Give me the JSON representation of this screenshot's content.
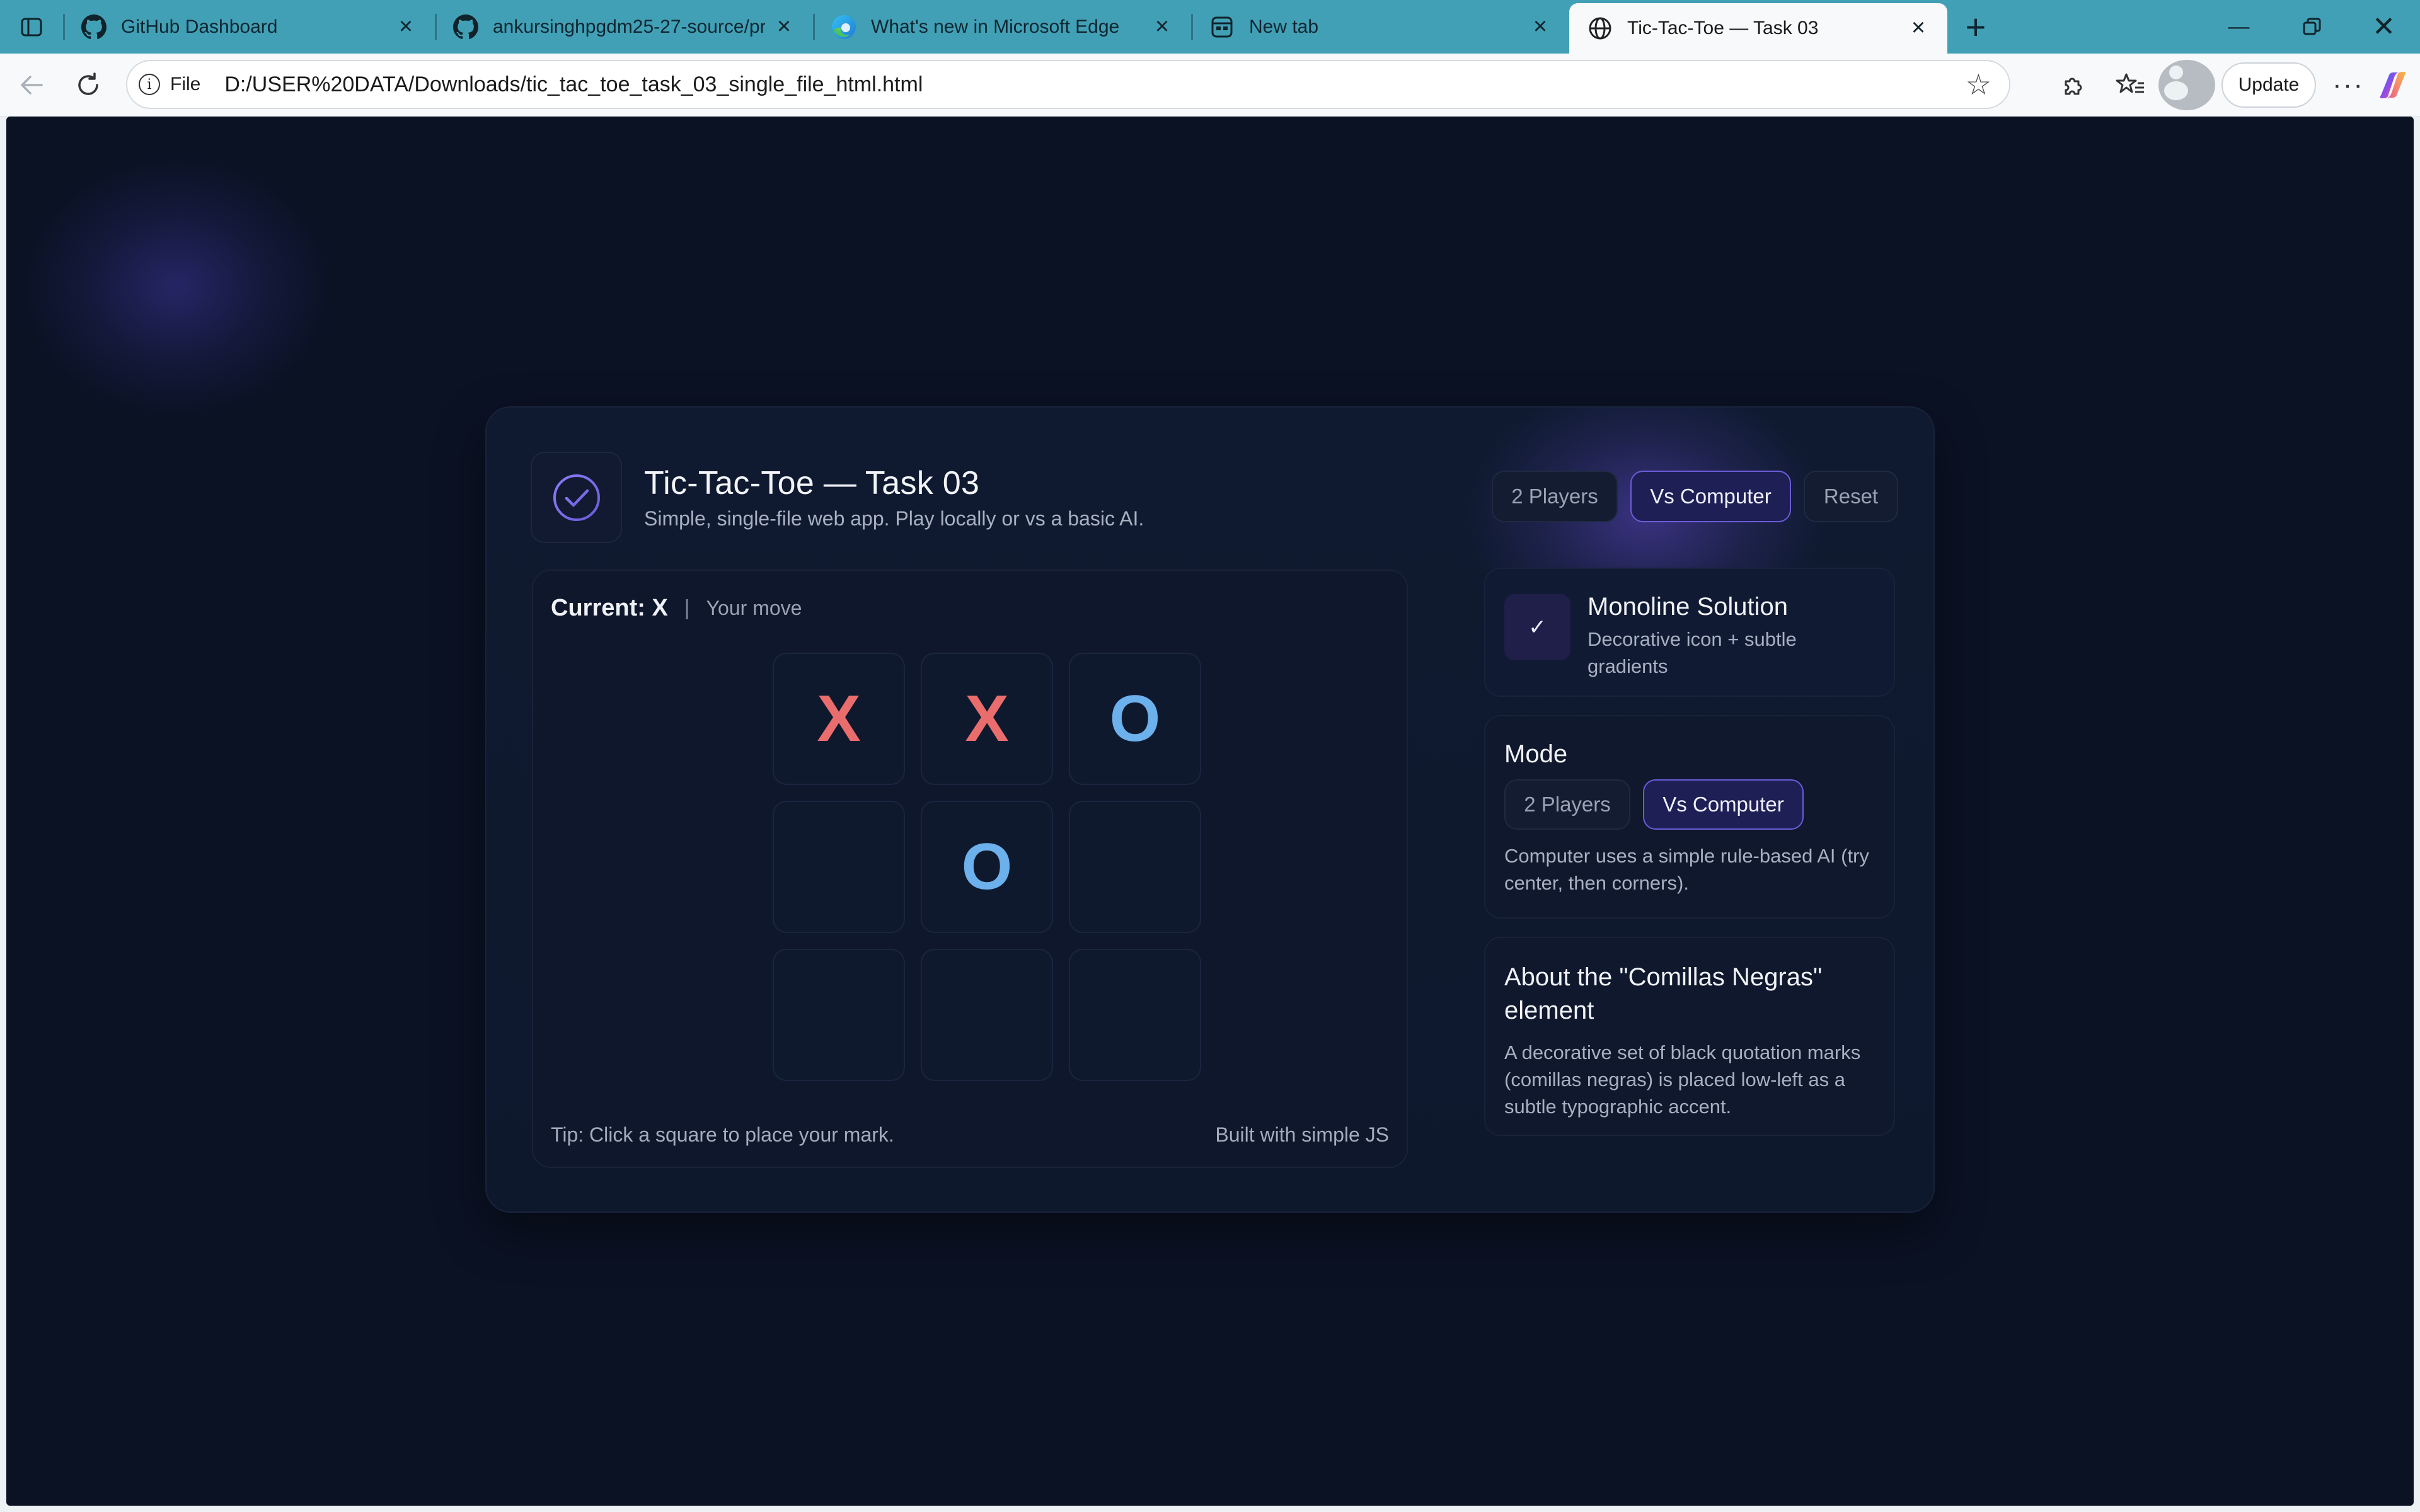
{
  "browser": {
    "tabs": [
      {
        "title": "GitHub Dashboard",
        "icon": "github-icon",
        "active": false
      },
      {
        "title": "ankursinghpgdm25-27-source/pr",
        "icon": "github-icon",
        "active": false
      },
      {
        "title": "What's new in Microsoft Edge",
        "icon": "edge-icon",
        "active": false
      },
      {
        "title": "New tab",
        "icon": "new-tab-icon",
        "active": false
      },
      {
        "title": "Tic-Tac-Toe — Task 03",
        "icon": "globe-icon",
        "active": true
      }
    ],
    "address": {
      "scheme_label": "File",
      "url": "D:/USER%20DATA/Downloads/tic_tac_toe_task_03_single_file_html.html"
    },
    "update_label": "Update",
    "more_label": "···"
  },
  "app": {
    "title": "Tic-Tac-Toe — Task 03",
    "subtitle": "Simple, single-file web app. Play locally or vs a basic AI.",
    "header_buttons": {
      "two_players": "2 Players",
      "vs_computer": "Vs Computer",
      "reset": "Reset"
    },
    "selected_mode": "Vs Computer",
    "status": {
      "current": "Current: X",
      "separator": "|",
      "message": "Your move"
    },
    "board": [
      "X",
      "X",
      "O",
      "",
      "O",
      "",
      "",
      "",
      ""
    ],
    "footer": {
      "tip": "Tip: Click a square to place your mark.",
      "built": "Built with simple JS"
    },
    "solution_card": {
      "title": "Monoline Solution",
      "description": "Decorative icon + subtle gradients"
    },
    "mode_card": {
      "title": "Mode",
      "two_players": "2 Players",
      "vs_computer": "Vs Computer",
      "description": "Computer uses a simple rule-based AI (try center, then corners)."
    },
    "about_card": {
      "title": "About the \"Comillas Negras\" element",
      "description": "A decorative set of black quotation marks (comillas negras) is placed low-left as a subtle typographic accent."
    }
  },
  "colors": {
    "page_bg": "#0b1224",
    "card_bg": "#0f1a30",
    "accent": "#6b5cd9",
    "x_mark": "#ea6d6d",
    "o_mark": "#6cb0ec",
    "tab_strip": "#41a0b5"
  }
}
